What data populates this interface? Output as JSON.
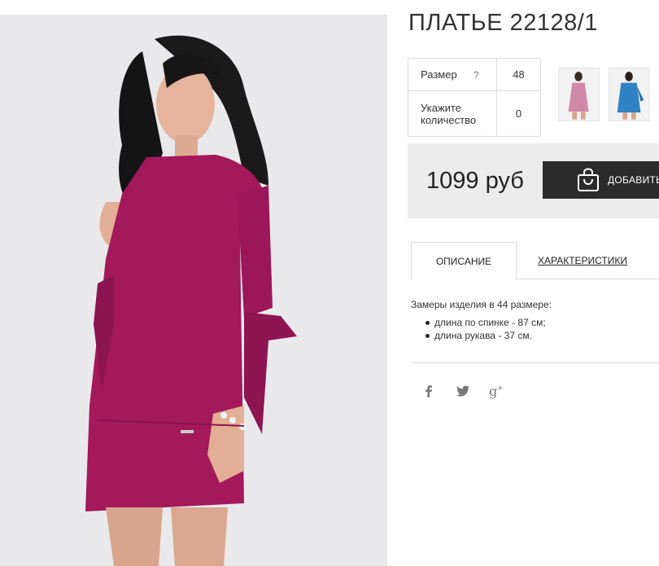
{
  "product": {
    "title": "ПЛАТЬЕ 22128/1",
    "main_image": "dress-photo",
    "thumbnails": [
      {
        "name": "pink-dress-thumbnail",
        "color": "#d08aa8"
      },
      {
        "name": "blue-dress-thumbnail",
        "color": "#2f82c4"
      }
    ]
  },
  "options": {
    "size_label": "Размер",
    "size_help": "?",
    "size_value": "48",
    "quantity_label": "Укажите количество",
    "quantity_value": "0"
  },
  "buy": {
    "price": "1099 руб",
    "button_label": "ДОБАВИТЬ",
    "button_icon": "shopping-bag-icon"
  },
  "tabs": [
    {
      "label": "ОПИСАНИЕ",
      "active": true
    },
    {
      "label": "ХАРАКТЕРИСТИКИ",
      "active": false
    }
  ],
  "description": {
    "intro": "Замеры изделия в 44 размере:",
    "items": [
      "длина по спинке - 87 см;",
      "длина рукава - 37 см."
    ]
  },
  "social": [
    "facebook-icon",
    "twitter-icon",
    "google-plus-icon"
  ],
  "colors": {
    "dress": "#a3195b",
    "buy_button": "#2b2b2b",
    "buy_box": "#ececec",
    "photo_bg": "#e9e9ec"
  }
}
